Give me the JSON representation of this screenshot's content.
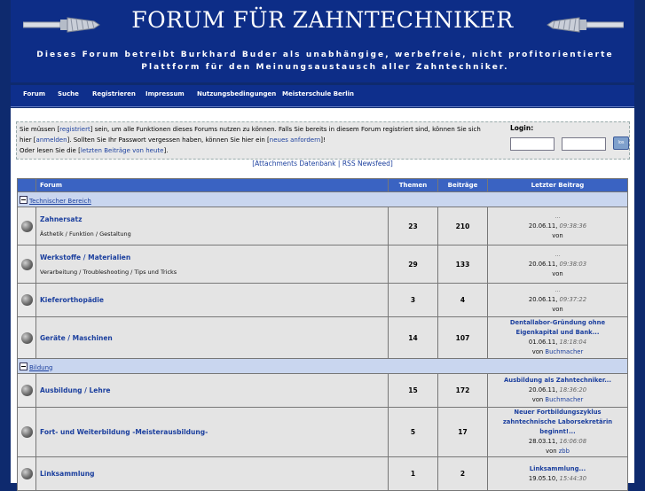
{
  "header": {
    "title": "FORUM FÜR ZAHNTECHNIKER",
    "subtitle": "Dieses Forum betreibt Burkhard Buder als unabhängige, werbefreie, nicht profitorientierte Plattform für den Meinungsaustausch aller Zahntechniker."
  },
  "nav": [
    "Forum",
    "Suche",
    "Registrieren",
    "Impressum",
    "Nutzungsbedingungen",
    "Meisterschule Berlin"
  ],
  "login": {
    "line1_a": "Sie müssen [",
    "link_register": "registriert",
    "line1_b": "] sein, um alle Funktionen dieses Forums nutzen zu können. Falls Sie bereits in diesem Forum registriert sind, können Sie sich",
    "line2_a": "hier [",
    "link_login": "anmelden",
    "line2_b": "]. Sollten Sie Ihr Passwort vergessen haben, können Sie hier ein [",
    "link_request": "neues anfordern",
    "line2_c": "]!",
    "line3_a": "Oder lesen Sie die [",
    "link_latest": "letzten Beiträge von heute",
    "line3_b": "].",
    "label": "Login:",
    "button": "los"
  },
  "feeds": {
    "attachments": "Attachments Datenbank",
    "separator": "|",
    "rss": "RSS Newsfeed"
  },
  "table": {
    "headers": [
      "Forum",
      "Themen",
      "Beiträge",
      "Letzter Beitrag"
    ]
  },
  "categories": [
    {
      "title": "Technischer Bereich",
      "forums": [
        {
          "name": "Zahnersatz",
          "desc": "Ästhetik / Funktion / Gestaltung",
          "themen": "23",
          "beitraege": "210",
          "last_title": "...",
          "last_date": "20.06.11,",
          "last_time": "09:38:36",
          "last_by": "von",
          "last_user": ""
        },
        {
          "name": "Werkstoffe / Materialien",
          "desc": "Verarbeitung / Troubleshooting / Tips und Tricks",
          "themen": "29",
          "beitraege": "133",
          "last_title": "...",
          "last_date": "20.06.11,",
          "last_time": "09:38:03",
          "last_by": "von",
          "last_user": ""
        },
        {
          "name": "Kieferorthopädie",
          "desc": "",
          "themen": "3",
          "beitraege": "4",
          "last_title": "...",
          "last_date": "20.06.11,",
          "last_time": "09:37:22",
          "last_by": "von",
          "last_user": ""
        },
        {
          "name": "Geräte / Maschinen",
          "desc": "",
          "themen": "14",
          "beitraege": "107",
          "last_title": "Dentallabor-Gründung ohne Eigenkapital und Bank...",
          "last_date": "01.06.11,",
          "last_time": "18:18:04",
          "last_by": "von",
          "last_user": "Buchmacher"
        }
      ]
    },
    {
      "title": "Bildung",
      "forums": [
        {
          "name": "Ausbildung / Lehre",
          "desc": "",
          "themen": "15",
          "beitraege": "172",
          "last_title": "Ausbildung als Zahntechniker...",
          "last_date": "20.06.11,",
          "last_time": "18:36:20",
          "last_by": "von",
          "last_user": "Buchmacher"
        },
        {
          "name": "Fort- und Weiterbildung -Meisterausbildung-",
          "desc": "",
          "themen": "5",
          "beitraege": "17",
          "last_title": "Neuer Fortbildungszyklus zahntechnische Laborsekretärin beginnt!...",
          "last_date": "28.03.11,",
          "last_time": "16:06:08",
          "last_by": "von",
          "last_user": "zbb"
        },
        {
          "name": "Linksammlung",
          "desc": "",
          "themen": "1",
          "beitraege": "2",
          "last_title": "Linksammlung...",
          "last_date": "19.05.10,",
          "last_time": "15:44:30",
          "last_by": "",
          "last_user": ""
        }
      ]
    }
  ]
}
